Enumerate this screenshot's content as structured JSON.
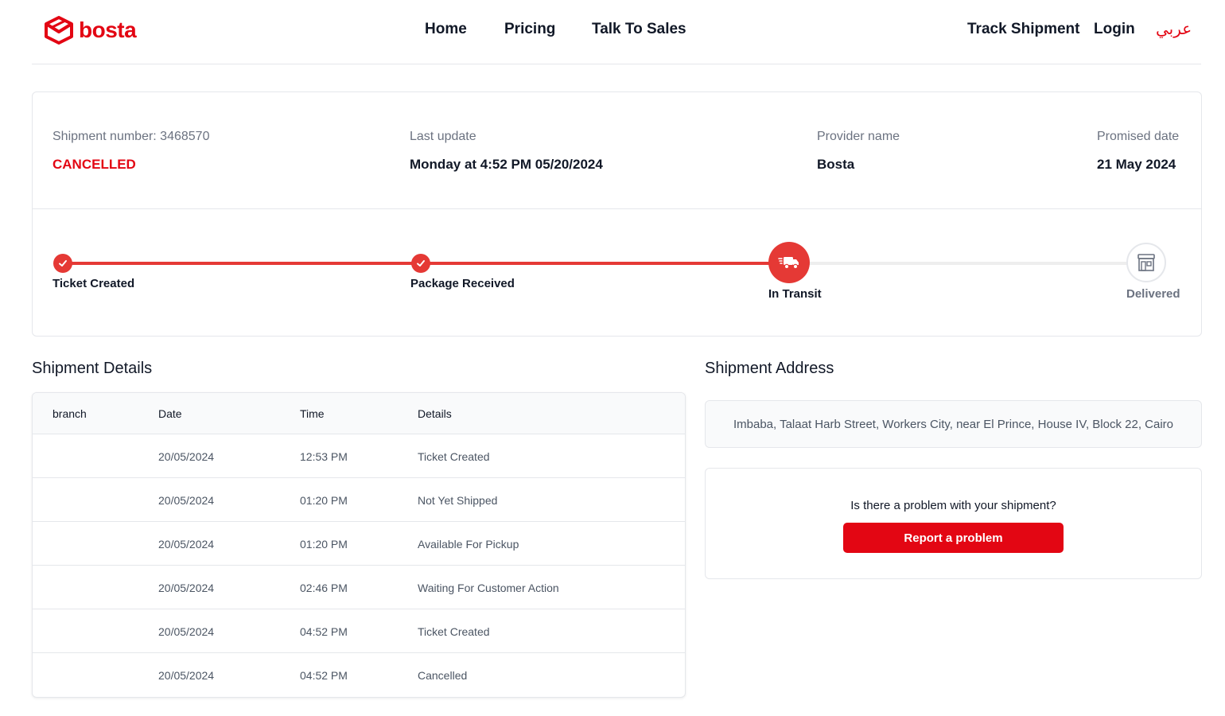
{
  "brand": {
    "name": "bosta",
    "accent": "#e30613"
  },
  "nav": {
    "home": "Home",
    "pricing": "Pricing",
    "talk_to_sales": "Talk To Sales",
    "track_shipment": "Track Shipment",
    "login": "Login",
    "language": "عربي"
  },
  "summary": {
    "shipment_number_label": "Shipment number: 3468570",
    "status": "CANCELLED",
    "last_update_label": "Last update",
    "last_update_value": "Monday at 4:52 PM 05/20/2024",
    "provider_label": "Provider name",
    "provider_value": "Bosta",
    "promised_label": "Promised date",
    "promised_value": "21 May 2024"
  },
  "progress": {
    "steps": [
      {
        "label": "Ticket Created",
        "state": "done"
      },
      {
        "label": "Package Received",
        "state": "done"
      },
      {
        "label": "In Transit",
        "state": "current"
      },
      {
        "label": "Delivered",
        "state": "pending"
      }
    ]
  },
  "details": {
    "title": "Shipment Details",
    "columns": [
      "branch",
      "Date",
      "Time",
      "Details"
    ],
    "rows": [
      {
        "branch": "",
        "date": "20/05/2024",
        "time": "12:53 PM",
        "details": "Ticket Created"
      },
      {
        "branch": "",
        "date": "20/05/2024",
        "time": "01:20 PM",
        "details": "Not Yet Shipped"
      },
      {
        "branch": "",
        "date": "20/05/2024",
        "time": "01:20 PM",
        "details": "Available For Pickup"
      },
      {
        "branch": "",
        "date": "20/05/2024",
        "time": "02:46 PM",
        "details": "Waiting For Customer Action"
      },
      {
        "branch": "",
        "date": "20/05/2024",
        "time": "04:52 PM",
        "details": "Ticket Created"
      },
      {
        "branch": "",
        "date": "20/05/2024",
        "time": "04:52 PM",
        "details": "Cancelled"
      }
    ]
  },
  "address": {
    "title": "Shipment Address",
    "text": "Imbaba, Talaat Harb Street, Workers City, near El Prince, House IV, Block 22, Cairo"
  },
  "problem": {
    "question": "Is there a problem with your shipment?",
    "button": "Report a problem"
  }
}
